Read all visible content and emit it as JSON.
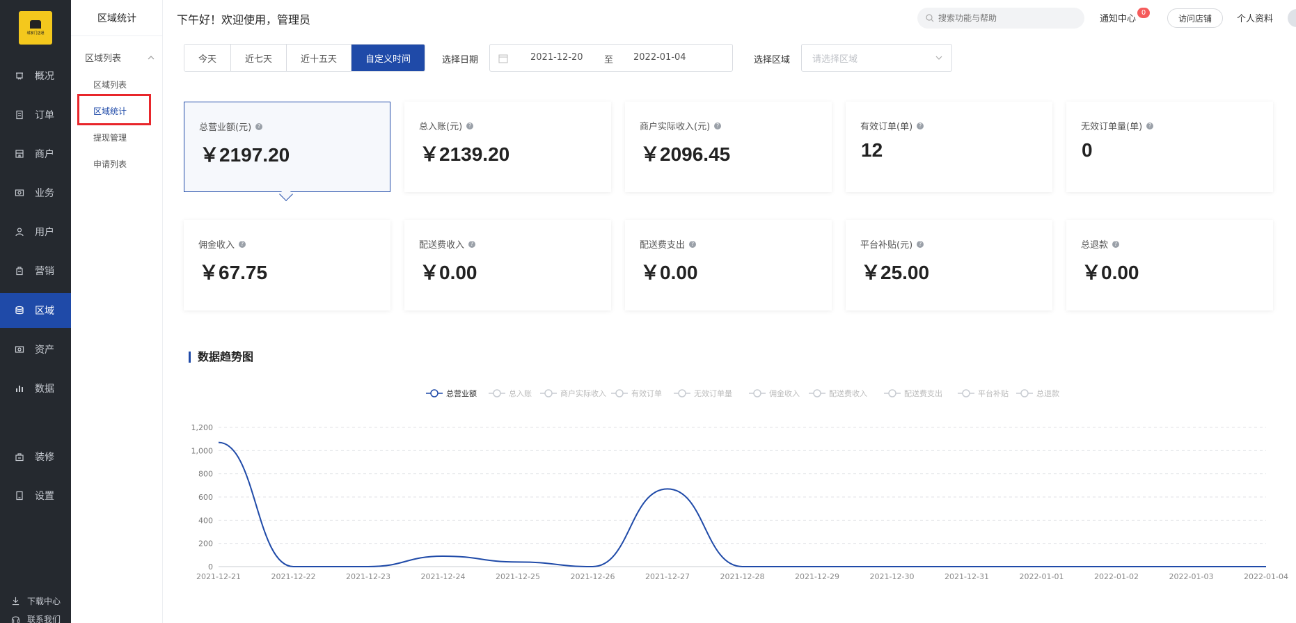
{
  "nav": {
    "logo_text": "城家门店通",
    "items": [
      {
        "label": "概况",
        "icon": "dashboard-icon"
      },
      {
        "label": "订单",
        "icon": "order-icon"
      },
      {
        "label": "商户",
        "icon": "store-icon"
      },
      {
        "label": "业务",
        "icon": "business-icon"
      },
      {
        "label": "用户",
        "icon": "user-icon"
      },
      {
        "label": "营销",
        "icon": "marketing-icon"
      },
      {
        "label": "区域",
        "icon": "region-icon"
      },
      {
        "label": "资产",
        "icon": "asset-icon"
      },
      {
        "label": "数据",
        "icon": "data-icon"
      },
      {
        "label": "装修",
        "icon": "decoration-icon"
      },
      {
        "label": "设置",
        "icon": "settings-icon"
      }
    ],
    "footer": [
      "下载中心",
      "联系我们"
    ]
  },
  "subnav": {
    "title": "区域统计",
    "group": "区域列表",
    "items": [
      "区域列表",
      "区域统计",
      "提现管理",
      "申请列表"
    ]
  },
  "header": {
    "greeting": "下午好！欢迎使用，管理员",
    "search_placeholder": "搜索功能与帮助",
    "notify_label": "通知中心",
    "notify_count": "0",
    "visit_label": "访问店铺",
    "profile_label": "个人资料"
  },
  "filters": {
    "tabs": [
      "今天",
      "近七天",
      "近十五天",
      "自定义时间"
    ],
    "date_label": "选择日期",
    "date_start": "2021-12-20",
    "date_to": "至",
    "date_end": "2022-01-04",
    "area_label": "选择区域",
    "area_placeholder": "请选择区域"
  },
  "cards": [
    {
      "label": "总营业额(元)",
      "value": "￥2197.20"
    },
    {
      "label": "总入账(元)",
      "value": "￥2139.20"
    },
    {
      "label": "商户实际收入(元)",
      "value": "￥2096.45"
    },
    {
      "label": "有效订单(单)",
      "value": "12"
    },
    {
      "label": "无效订单量(单)",
      "value": "0"
    },
    {
      "label": "佣金收入",
      "value": "￥67.75"
    },
    {
      "label": "配送费收入",
      "value": "￥0.00"
    },
    {
      "label": "配送费支出",
      "value": "￥0.00"
    },
    {
      "label": "平台补贴(元)",
      "value": "￥25.00"
    },
    {
      "label": "总退款",
      "value": "￥0.00"
    }
  ],
  "chart_title": "数据趋势图",
  "colors": {
    "accent": "#1f4aa8",
    "nav_bg": "#25292f",
    "highlight": "#e8262b"
  },
  "chart_data": {
    "type": "line",
    "legend": [
      "总营业额",
      "总入账",
      "商户实际收入",
      "有效订单",
      "无效订单量",
      "佣金收入",
      "配送费收入",
      "配送费支出",
      "平台补贴",
      "总退款"
    ],
    "legend_active": "总营业额",
    "x": [
      "2021-12-21",
      "2021-12-22",
      "2021-12-23",
      "2021-12-24",
      "2021-12-25",
      "2021-12-26",
      "2021-12-27",
      "2021-12-28",
      "2021-12-29",
      "2021-12-30",
      "2021-12-31",
      "2022-01-01",
      "2022-01-02",
      "2022-01-03",
      "2022-01-04"
    ],
    "series": [
      {
        "name": "总营业额",
        "values": [
          1070,
          0,
          0,
          90,
          40,
          0,
          670,
          0,
          0,
          0,
          0,
          0,
          0,
          0,
          0
        ]
      }
    ],
    "ylim": [
      0,
      1200
    ],
    "yticks": [
      "0",
      "200",
      "400",
      "600",
      "800",
      "1,000",
      "1,200"
    ],
    "grid": true,
    "legend_position": "top"
  }
}
